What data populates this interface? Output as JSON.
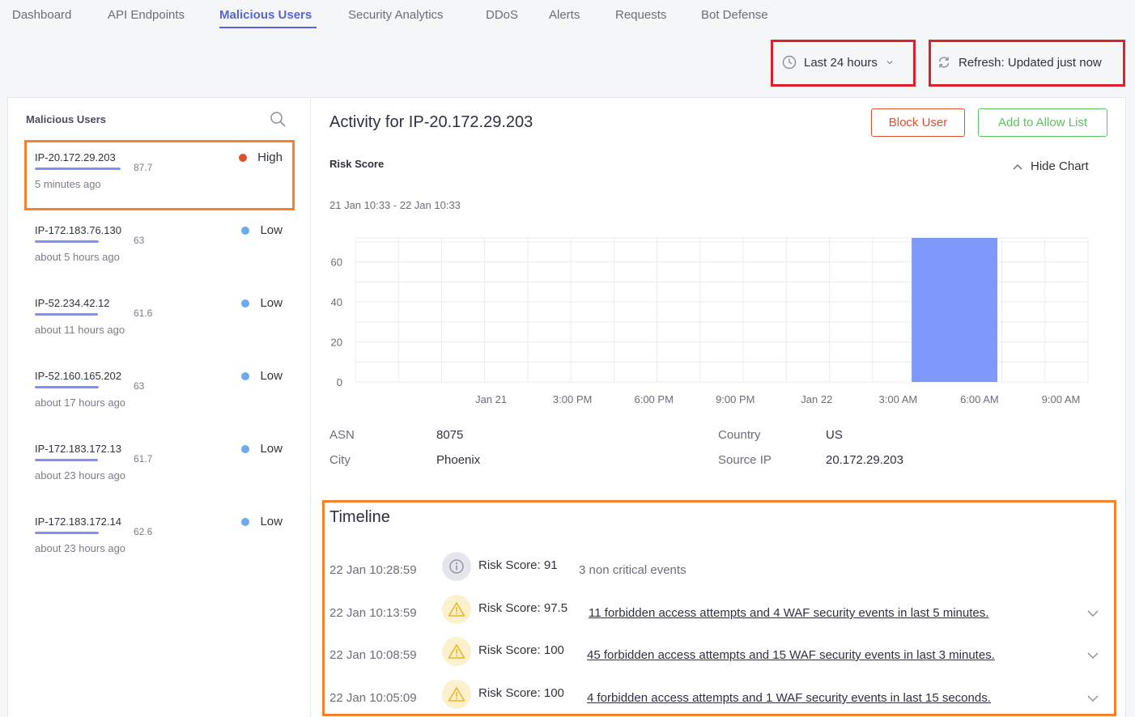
{
  "nav": {
    "tabs": [
      {
        "label": "Dashboard"
      },
      {
        "label": "API Endpoints"
      },
      {
        "label": "Malicious Users"
      },
      {
        "label": "Security Analytics"
      },
      {
        "label": "DDoS"
      },
      {
        "label": "Alerts"
      },
      {
        "label": "Requests"
      },
      {
        "label": "Bot Defense"
      }
    ],
    "active_tab": "Malicious Users"
  },
  "toolbar": {
    "time_range_label": "Last 24 hours",
    "refresh_label": "Refresh: Updated just now"
  },
  "users_panel": {
    "title": "Malicious Users",
    "users": [
      {
        "ip": "IP-20.172.29.203",
        "score": "87.7",
        "score_value": 87.7,
        "time": "5 minutes ago",
        "level": "High",
        "level_color": "#e0502d",
        "selected": true
      },
      {
        "ip": "IP-172.183.76.130",
        "score": "63",
        "score_value": 63,
        "time": "about 5 hours ago",
        "level": "Low",
        "level_color": "#6aaaf0"
      },
      {
        "ip": "IP-52.234.42.12",
        "score": "61.6",
        "score_value": 61.6,
        "time": "about 11 hours ago",
        "level": "Low",
        "level_color": "#6aaaf0"
      },
      {
        "ip": "IP-52.160.165.202",
        "score": "63",
        "score_value": 63,
        "time": "about 17 hours ago",
        "level": "Low",
        "level_color": "#6aaaf0"
      },
      {
        "ip": "IP-172.183.172.13",
        "score": "61.7",
        "score_value": 61.7,
        "time": "about 23 hours ago",
        "level": "Low",
        "level_color": "#6aaaf0"
      },
      {
        "ip": "IP-172.183.172.14",
        "score": "62.6",
        "score_value": 62.6,
        "time": "about 23 hours ago",
        "level": "Low",
        "level_color": "#6aaaf0"
      }
    ]
  },
  "activity": {
    "title": "Activity for IP-20.172.29.203",
    "block_label": "Block User",
    "allow_label": "Add to Allow List",
    "chart_title": "Risk Score",
    "hide_chart_label": "Hide Chart",
    "range_label": "21 Jan 10:33 - 22 Jan 10:33",
    "details": {
      "asn_label": "ASN",
      "asn_value": "8075",
      "city_label": "City",
      "city_value": "Phoenix",
      "country_label": "Country",
      "country_value": "US",
      "source_ip_label": "Source IP",
      "source_ip_value": "20.172.29.203"
    }
  },
  "chart_data": {
    "type": "bar",
    "title": "Risk Score",
    "xlabel": "",
    "ylabel": "",
    "ylim": [
      0,
      72
    ],
    "yticks": [
      0,
      20,
      40,
      60
    ],
    "xticks": [
      "Jan 21",
      "3:00 PM",
      "6:00 PM",
      "9:00 PM",
      "Jan 22",
      "3:00 AM",
      "6:00 AM",
      "9:00 AM"
    ],
    "x_range_hours": [
      -2.5,
      11
    ],
    "bars": [
      {
        "x_start_hours": 7.75,
        "x_end_hours": 9.33,
        "value": 72
      }
    ],
    "grid": true,
    "bar_color": "#7f98fb"
  },
  "timeline": {
    "title": "Timeline",
    "events": [
      {
        "time": "22 Jan 10:28:59",
        "icon": "info-icon",
        "score": "Risk Score: 91",
        "desc": "3 non critical events",
        "link": false
      },
      {
        "time": "22 Jan 10:13:59",
        "icon": "warning-icon",
        "score": "Risk Score: 97.5",
        "desc": "11 forbidden access attempts and 4 WAF security events in last 5 minutes.",
        "link": true
      },
      {
        "time": "22 Jan 10:08:59",
        "icon": "warning-icon",
        "score": "Risk Score: 100",
        "desc": "45 forbidden access attempts and 15 WAF security events in last 3 minutes.",
        "link": true
      },
      {
        "time": "22 Jan 10:05:09",
        "icon": "warning-icon",
        "score": "Risk Score: 100",
        "desc": "4 forbidden access attempts and 1 WAF security events in last 15 seconds.",
        "link": true
      }
    ]
  }
}
